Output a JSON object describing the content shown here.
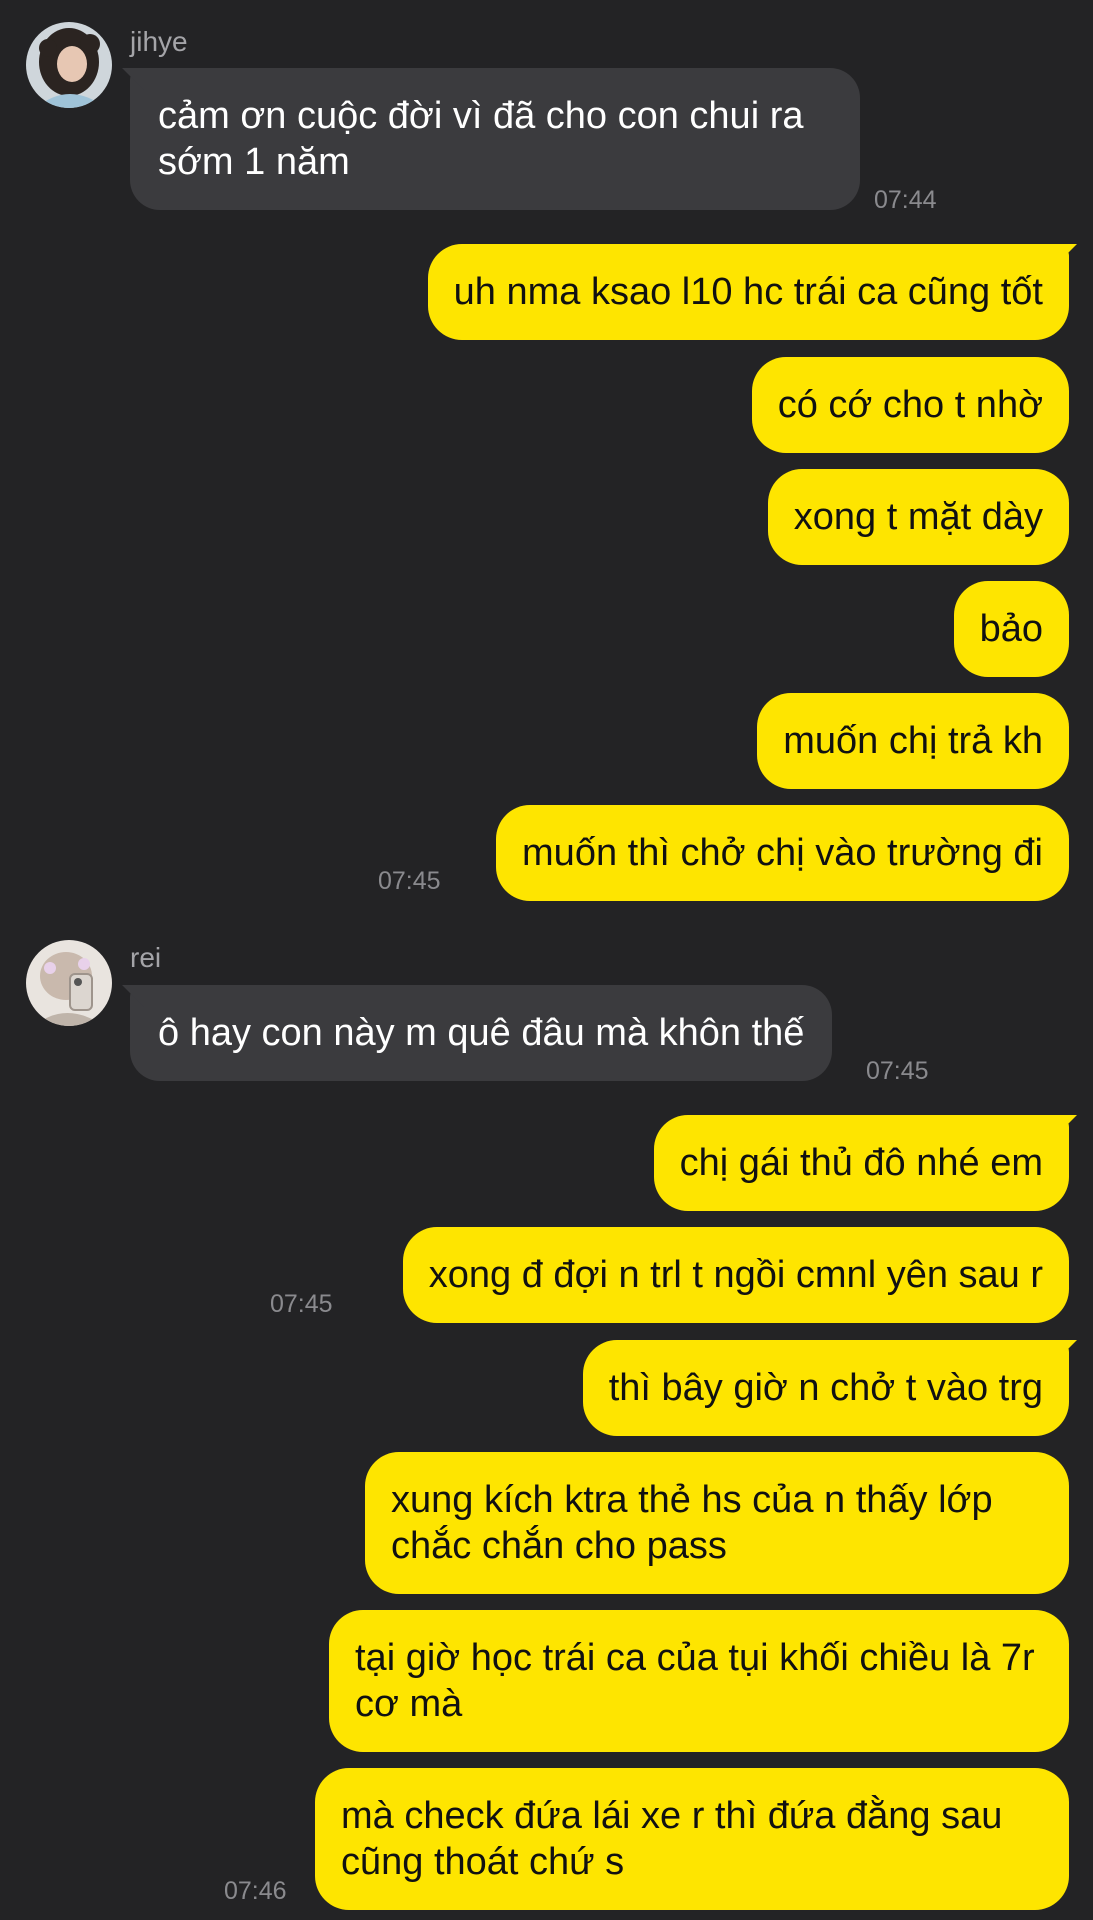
{
  "colors": {
    "background": "#232325",
    "incoming_bubble": "#3b3b3e",
    "outgoing_bubble": "#fee500",
    "timestamp": "#8a8a8e",
    "sender_name": "#a4a4a8"
  },
  "messages": [
    {
      "sender": "jihye",
      "avatar": "jihye-avatar",
      "text": "cảm ơn cuộc đời vì đã cho con chui ra sớm 1 năm",
      "time": "07:44"
    },
    {
      "text": "uh nma ksao l10 hc trái ca cũng tốt"
    },
    {
      "text": "có cớ cho t nhờ"
    },
    {
      "text": "xong t mặt dày"
    },
    {
      "text": "bảo"
    },
    {
      "text": "muốn chị trả kh"
    },
    {
      "text": "muốn thì chở chị vào trường đi",
      "time": "07:45"
    },
    {
      "sender": "rei",
      "avatar": "rei-avatar",
      "text": "ô hay con này m quê đâu mà khôn thế",
      "time": "07:45"
    },
    {
      "text": "chị gái thủ đô nhé em"
    },
    {
      "text": "xong đ đợi n trl t ngồi cmnl yên sau r",
      "time": "07:45"
    },
    {
      "text": "thì bây giờ n chở t vào trg"
    },
    {
      "text": "xung kích ktra thẻ hs của n thấy lớp chắc chắn cho pass"
    },
    {
      "text": "tại giờ học trái ca của tụi khối chiều là 7r cơ mà"
    },
    {
      "text": "mà check đứa lái xe r thì đứa đằng sau cũng thoát chứ s",
      "time": "07:46"
    }
  ]
}
